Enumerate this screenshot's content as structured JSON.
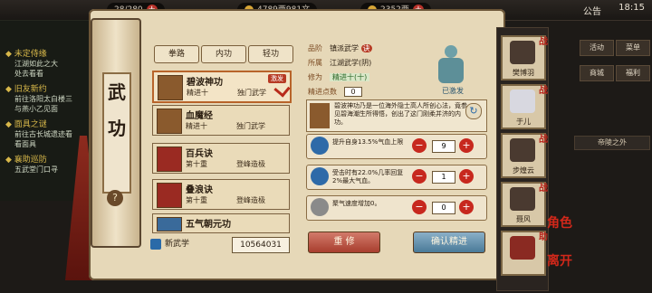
{
  "topbar": {
    "res1": "28/280",
    "res2": "4789两981文",
    "res3": "2352两",
    "notice": "公告",
    "clock": "18:15"
  },
  "quests": [
    {
      "title": "◆ 未定侍缘",
      "desc": [
        "江湖如此之大",
        "处去看看"
      ]
    },
    {
      "title": "◆ 旧友新约",
      "desc": [
        "前往洛阳太白楼三",
        "与燕小乙见面"
      ]
    },
    {
      "title": "◆ 面具之谜",
      "desc": [
        "前往古长城遗迹看",
        "看面具"
      ]
    },
    {
      "title": "◆ 襄助巡防",
      "desc": [
        "五武堂门口寻"
      ]
    }
  ],
  "scroll": {
    "title_chars": [
      "武",
      "功"
    ],
    "help": "?"
  },
  "tabs": [
    "拳路",
    "内功",
    "轻功"
  ],
  "skills": [
    {
      "name": "碧波神功",
      "level": "精进十",
      "type": "独门武学",
      "badge": "激发",
      "selected": true
    },
    {
      "name": "血魔经",
      "level": "精进十",
      "type": "独门武学"
    },
    {
      "name": "百兵诀",
      "level": "第十重",
      "type": "登峰造极"
    },
    {
      "name": "叠浪诀",
      "level": "第十重",
      "type": "登峰造极"
    },
    {
      "name": "五气朝元功",
      "level": "",
      "type": ""
    }
  ],
  "bottom": {
    "new_label": "新武学",
    "points": "10564031"
  },
  "details": {
    "grade_k": "品阶",
    "grade_v": "镇派武学",
    "grade_badge": "诀",
    "source_k": "所属",
    "source_v": "江湖武学(阴)",
    "cult_k": "修为",
    "cult_v": "精进十(十)",
    "pts_k": "精进点数",
    "pts_v": "0",
    "figure_label": "已激发",
    "desc": "碧波神功乃是一位海外隐士高人所创心法，竟参见碧海潮生所得悟，创出了这门刚柔并济的内功。"
  },
  "stats": [
    {
      "text": "提升自身13.5%气血上限",
      "value": "9"
    },
    {
      "text": "受击时有22.0%几率回复2%最大气血。",
      "value": "1"
    },
    {
      "text": "聚气速度增加0。",
      "value": "0"
    }
  ],
  "buttons": {
    "reset": "重 修",
    "confirm": "确认精进"
  },
  "roster": [
    {
      "name": "樊博羽",
      "fight": "战"
    },
    {
      "name": "于儿",
      "fight": "战"
    },
    {
      "name": "步煌云",
      "fight": "战"
    },
    {
      "name": "聂风",
      "fight": "战"
    },
    {
      "name": "",
      "fight": "助"
    }
  ],
  "menu": [
    "活动",
    "菜单",
    "商城",
    "福利"
  ],
  "right_tag": "帝陵之外",
  "side_tags": {
    "a": "角色",
    "b": "离开"
  }
}
